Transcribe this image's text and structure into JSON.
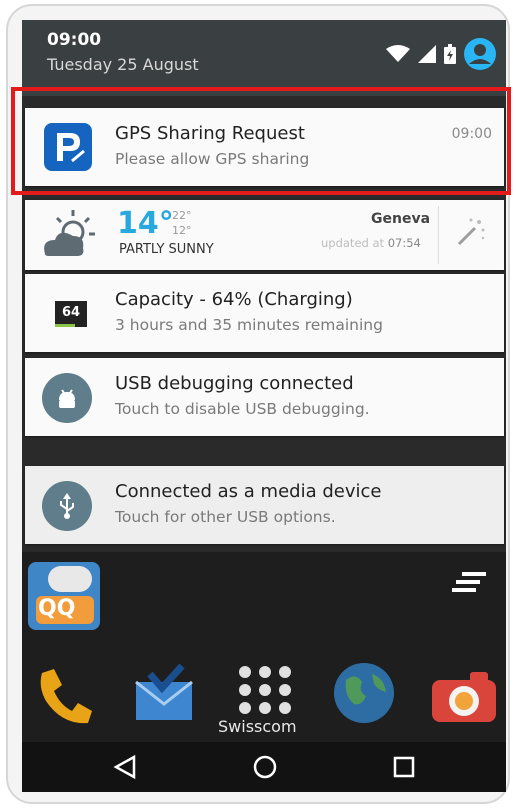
{
  "status_bar": {
    "time": "09:00",
    "date": "Tuesday 25 August"
  },
  "gps_notification": {
    "title": "GPS Sharing Request",
    "message": "Please allow GPS sharing",
    "time": "09:00"
  },
  "weather_notification": {
    "temperature": "14°",
    "high": "22°",
    "low": "12°",
    "condition": "PARTLY SUNNY",
    "city": "Geneva",
    "updated_prefix": "updated at ",
    "updated_time": "07:54"
  },
  "battery_notification": {
    "badge": "64",
    "title": "Capacity - 64% (Charging)",
    "message": "3 hours and 35 minutes remaining"
  },
  "usb_debug_notification": {
    "title": "USB debugging connected",
    "message": "Touch to disable USB debugging."
  },
  "media_notification": {
    "title": "Connected as a media device",
    "message": "Touch for other USB options."
  },
  "home": {
    "folder_label": "Swisscom"
  },
  "colors": {
    "highlight": "#e41b1b",
    "app_icon_blue": "#1565c0",
    "weather_blue": "#29a8e0",
    "status_bar": "#3a3f42"
  }
}
